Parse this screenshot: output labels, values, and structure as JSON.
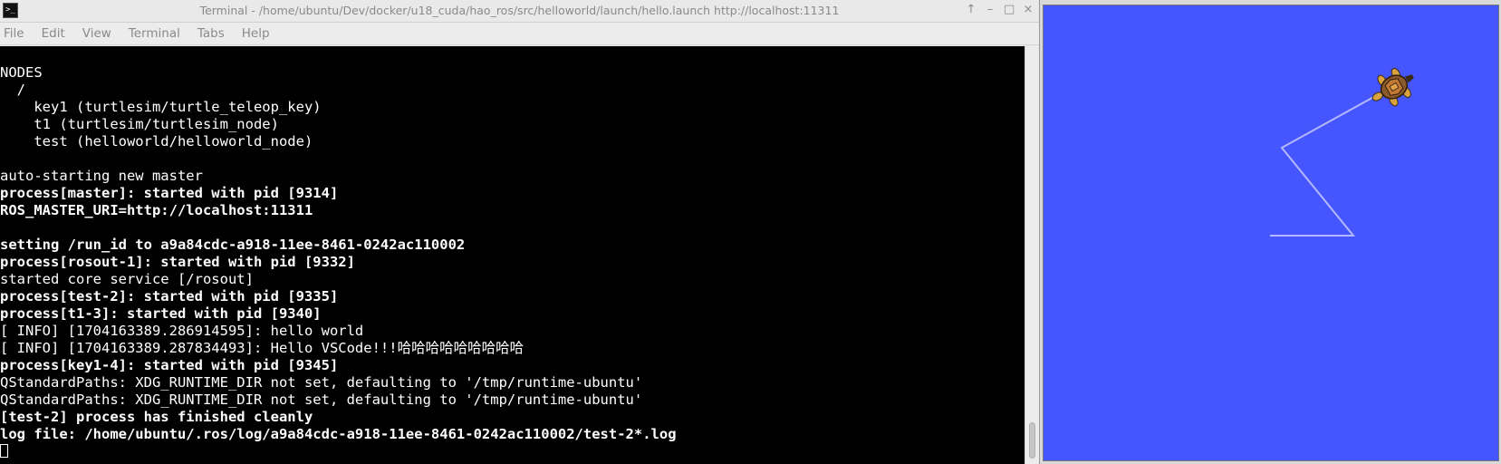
{
  "terminal": {
    "title": "Terminal - /home/ubuntu/Dev/docker/u18_cuda/hao_ros/src/helloworld/launch/hello.launch http://localhost:11311",
    "app_icon": "terminal-icon",
    "controls": {
      "pin": "↑",
      "minimize": "–",
      "maximize": "□",
      "close": "×"
    },
    "menu": [
      "File",
      "Edit",
      "View",
      "Terminal",
      "Tabs",
      "Help"
    ],
    "lines": [
      {
        "text": "NODES",
        "bold": false
      },
      {
        "text": "  /",
        "bold": false
      },
      {
        "text": "    key1 (turtlesim/turtle_teleop_key)",
        "bold": false
      },
      {
        "text": "    t1 (turtlesim/turtlesim_node)",
        "bold": false
      },
      {
        "text": "    test (helloworld/helloworld_node)",
        "bold": false
      },
      {
        "text": "",
        "bold": false
      },
      {
        "text": "auto-starting new master",
        "bold": false
      },
      {
        "text": "process[master]: started with pid [9314]",
        "bold": true
      },
      {
        "text": "ROS_MASTER_URI=http://localhost:11311",
        "bold": true
      },
      {
        "text": "",
        "bold": false
      },
      {
        "text": "setting /run_id to a9a84cdc-a918-11ee-8461-0242ac110002",
        "bold": true
      },
      {
        "text": "process[rosout-1]: started with pid [9332]",
        "bold": true
      },
      {
        "text": "started core service [/rosout]",
        "bold": false
      },
      {
        "text": "process[test-2]: started with pid [9335]",
        "bold": true
      },
      {
        "text": "process[t1-3]: started with pid [9340]",
        "bold": true
      },
      {
        "text": "[ INFO] [1704163389.286914595]: hello world",
        "bold": false
      },
      {
        "text": "[ INFO] [1704163389.287834493]: Hello VSCode!!!哈哈哈哈哈哈哈哈哈",
        "bold": false
      },
      {
        "text": "process[key1-4]: started with pid [9345]",
        "bold": true
      },
      {
        "text": "QStandardPaths: XDG_RUNTIME_DIR not set, defaulting to '/tmp/runtime-ubuntu'",
        "bold": false
      },
      {
        "text": "QStandardPaths: XDG_RUNTIME_DIR not set, defaulting to '/tmp/runtime-ubuntu'",
        "bold": false
      },
      {
        "text": "[test-2] process has finished cleanly",
        "bold": true
      },
      {
        "text": "log file: /home/ubuntu/.ros/log/a9a84cdc-a918-11ee-8461-0242ac110002/test-2*.log",
        "bold": true
      }
    ],
    "colors": {
      "background": "#000000",
      "foreground": "#ffffff"
    }
  },
  "turtlesim": {
    "background_color": "#4556ff",
    "trail_color": "#b3b8ff",
    "turtle_icon": "turtle-icon"
  }
}
